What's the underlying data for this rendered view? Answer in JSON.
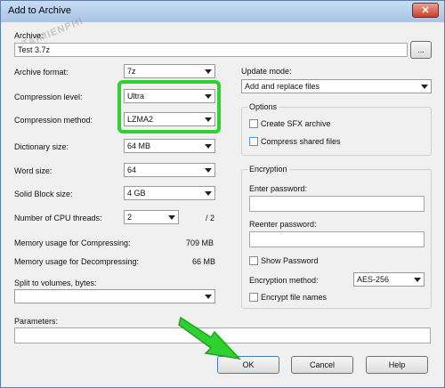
{
  "window": {
    "title": "Add to Archive",
    "close_icon": "close-icon",
    "titlebar_color": "#a8c4e6"
  },
  "watermark": "TAIMIENPHI",
  "archive": {
    "label": "Archive:",
    "value": "Test 3.7z",
    "browse_label": "..."
  },
  "left": {
    "archive_format": {
      "label": "Archive format:",
      "value": "7z"
    },
    "compression_level": {
      "label": "Compression level:",
      "value": "Ultra"
    },
    "compression_method": {
      "label": "Compression method:",
      "value": "LZMA2"
    },
    "dictionary_size": {
      "label": "Dictionary size:",
      "value": "64 MB"
    },
    "word_size": {
      "label": "Word size:",
      "value": "64"
    },
    "solid_block_size": {
      "label": "Solid Block size:",
      "value": "4 GB"
    },
    "cpu_threads": {
      "label": "Number of CPU threads:",
      "value": "2",
      "total": "/ 2"
    },
    "memory_compress": {
      "label": "Memory usage for Compressing:",
      "value": "709 MB"
    },
    "memory_decompress": {
      "label": "Memory usage for Decompressing:",
      "value": "66 MB"
    },
    "split": {
      "label": "Split to volumes, bytes:",
      "value": ""
    },
    "parameters": {
      "label": "Parameters:",
      "value": ""
    }
  },
  "right": {
    "update_mode": {
      "label": "Update mode:",
      "value": "Add and replace files"
    },
    "options": {
      "legend": "Options",
      "create_sfx": {
        "label": "Create SFX archive",
        "checked": false
      },
      "compress_shared": {
        "label": "Compress shared files",
        "checked": false
      }
    },
    "encryption": {
      "legend": "Encryption",
      "enter_password_label": "Enter password:",
      "reenter_password_label": "Reenter password:",
      "show_password": {
        "label": "Show Password",
        "checked": false
      },
      "method_label": "Encryption method:",
      "method_value": "AES-256",
      "encrypt_names": {
        "label": "Encrypt file names",
        "checked": false
      }
    }
  },
  "buttons": {
    "ok": "OK",
    "cancel": "Cancel",
    "help": "Help"
  },
  "annotations": {
    "highlight_color": "#2fd12f",
    "arrow_color": "#2fd12f"
  }
}
